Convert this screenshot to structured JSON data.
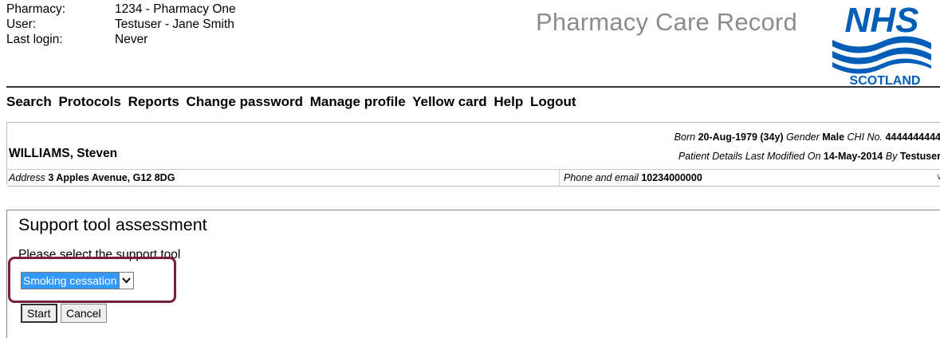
{
  "header": {
    "pharmacy_label": "Pharmacy:",
    "pharmacy_value": "1234 - Pharmacy One",
    "user_label": "User:",
    "user_value": "Testuser - Jane Smith",
    "last_login_label": "Last login:",
    "last_login_value": "Never",
    "app_title": "Pharmacy Care Record",
    "logo_top": "NHS",
    "logo_bottom": "SCOTLAND"
  },
  "menu": [
    "Search",
    "Protocols",
    "Reports",
    "Change password",
    "Manage profile",
    "Yellow card",
    "Help",
    "Logout"
  ],
  "patient": {
    "name": "WILLIAMS, Steven",
    "born_label": "Born",
    "dob": "20-Aug-1979",
    "age": "(34y)",
    "gender_label": "Gender",
    "gender": "Male",
    "chi_label": "CHI No.",
    "chi": "4444444444",
    "modified_label": "Patient Details Last Modified On",
    "modified_date": "14-May-2014",
    "by_label": "By",
    "by_user": "Testuser",
    "address_label": "Address",
    "address": "3 Apples Avenue, G12 8DG",
    "phone_label": "Phone and email",
    "phone": "10234000000"
  },
  "assessment": {
    "title": "Support tool assessment",
    "prompt": "Please select the support tool",
    "selected_tool": "Smoking cessation",
    "start_label": "Start",
    "cancel_label": "Cancel"
  },
  "colors": {
    "highlight_border": "#7a1f3a",
    "nhs_blue": "#005eb8",
    "selection": "#3399ff"
  }
}
